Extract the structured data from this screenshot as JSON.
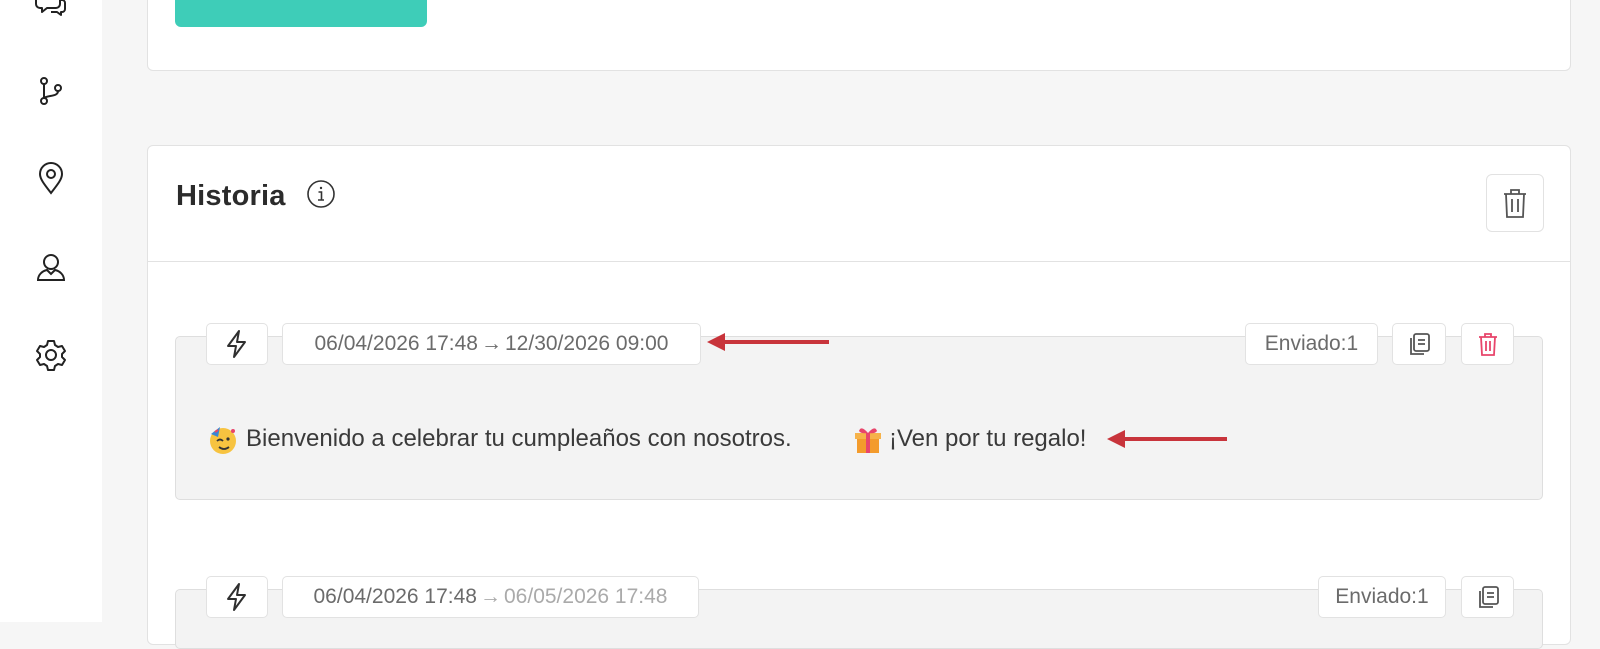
{
  "history": {
    "title": "Historia",
    "entries": [
      {
        "date_start": "06/04/2026 17:48",
        "arrow": "→",
        "date_end": "12/30/2026 09:00",
        "sent_label": "Enviado:1",
        "message": "Bienvenido a celebrar tu cumpleaños con nosotros.",
        "message_tail": "¡Ven por tu regalo!"
      },
      {
        "date_start": "06/04/2026 17:48",
        "arrow": "→",
        "date_end": "06/05/2026 17:48",
        "sent_label": "Enviado:1"
      }
    ]
  },
  "colors": {
    "accent": "#3ecdb8",
    "danger": "#e8456b",
    "annotation_arrow": "#c8343b",
    "bolt": "#2f2f2f"
  },
  "icons": [
    "chat-icon",
    "branch-icon",
    "location-pin-icon",
    "user-icon",
    "gear-icon",
    "info-icon",
    "trash-icon",
    "bolt-icon",
    "copy-icon",
    "party-face-emoji",
    "gift-emoji",
    "red-arrow"
  ]
}
